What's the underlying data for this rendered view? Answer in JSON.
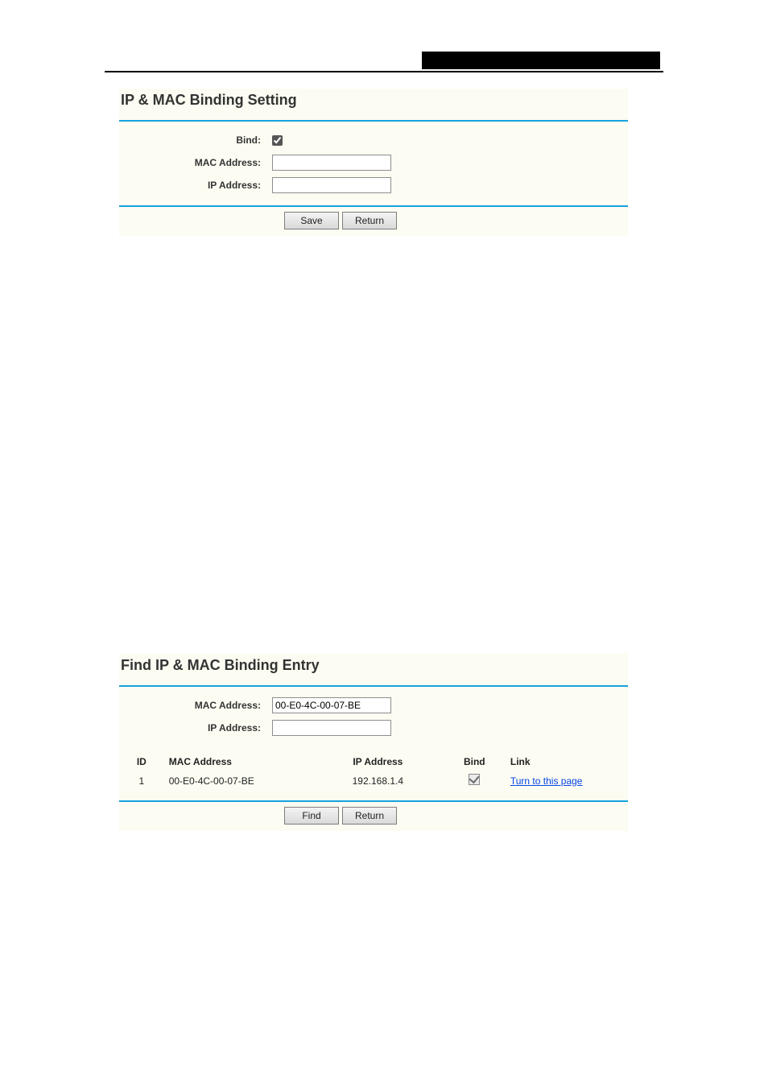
{
  "panel1": {
    "title": "IP & MAC Binding Setting",
    "bind_label": "Bind:",
    "bind_checked": true,
    "mac_label": "MAC Address:",
    "mac_value": "",
    "ip_label": "IP Address:",
    "ip_value": "",
    "save_label": "Save",
    "return_label": "Return"
  },
  "panel2": {
    "title": "Find IP & MAC Binding Entry",
    "mac_label": "MAC Address:",
    "mac_value": "00-E0-4C-00-07-BE",
    "ip_label": "IP Address:",
    "ip_value": "",
    "headers": {
      "id": "ID",
      "mac": "MAC Address",
      "ip": "IP Address",
      "bind": "Bind",
      "link": "Link"
    },
    "row": {
      "id": "1",
      "mac": "00-E0-4C-00-07-BE",
      "ip": "192.168.1.4",
      "bind_checked": true,
      "link_text": "Turn to this page"
    },
    "find_label": "Find",
    "return_label": "Return"
  }
}
